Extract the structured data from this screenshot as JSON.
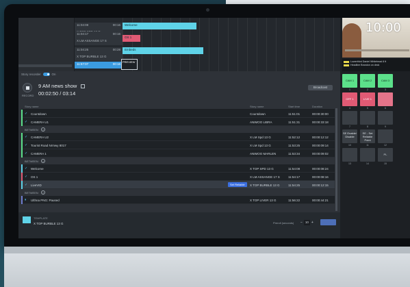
{
  "timeline": {
    "rows": [
      {
        "time": "11:04:08",
        "dur": "00:16",
        "label": "X TOP SPD 13 G"
      },
      {
        "time": "11:04:17",
        "dur": "00:16",
        "label": "X LM ASSANGE 17 S"
      },
      {
        "time": "11:04:25",
        "dur": "00:28",
        "label": "X TOP BURBLE 13 G"
      }
    ],
    "selected_time": "11:57:07",
    "selected_dur": "00:16",
    "blocks": [
      {
        "label": "Welcome",
        "color": "#5fd3e8"
      },
      {
        "label": "OS 1",
        "color": "#e05a74"
      },
      {
        "label": "Embeds",
        "color": "#5fd3e8"
      }
    ],
    "playhead_label": "PREVIEW"
  },
  "story_recorder": {
    "label": "Story recorder",
    "state": "On"
  },
  "show": {
    "record_label": "RECORD",
    "title": "9 AM news show",
    "elapsed": "00:02:50",
    "total": "03:14",
    "broadcast_label": "Broadcast"
  },
  "table": {
    "columns": [
      "Story name",
      "Story name",
      "Start time",
      "Duration"
    ],
    "rows": [
      {
        "kind": "row",
        "name": "Countdown",
        "story": "Countdown",
        "start": "11:51:01",
        "duration": "00:00:30:00",
        "bar": "#5ce08a"
      },
      {
        "kind": "row",
        "name": "CAMERA U1",
        "story": "ANIMOO LIBRA",
        "start": "11:51:31",
        "duration": "00:00:33:18",
        "bar": "#5ce08a"
      },
      {
        "kind": "divider",
        "name": "BETWEEN"
      },
      {
        "kind": "row",
        "name": "CAMERA U2",
        "story": "X LM Spd 13 G",
        "start": "11:52:12",
        "duration": "00:00:12:12",
        "bar": "#5ce08a"
      },
      {
        "kind": "row",
        "name": "Tourist Road Nrmwy 8017",
        "story": "X LM Spd 13 G",
        "start": "11:53:25",
        "duration": "00:00:09:14",
        "bar": "#5ce08a"
      },
      {
        "kind": "row",
        "name": "CAMERA 1",
        "story": "ANIMOO MARLEN",
        "start": "11:53:34",
        "duration": "00:00:09:02",
        "bar": "#5ce08a"
      },
      {
        "kind": "divider",
        "name": "BETWEEN"
      },
      {
        "kind": "row",
        "name": "Welcome",
        "story": "X TOP SPD 13 G",
        "start": "11:54:08",
        "duration": "00:00:08:24",
        "bar": "#5fd3e8"
      },
      {
        "kind": "row",
        "name": "OS 1",
        "story": "X LM ASSANGE 17 S",
        "start": "11:54:17",
        "duration": "00:00:08:16",
        "bar": "#e05a74"
      },
      {
        "kind": "row",
        "name": "LiveVID",
        "story": "X TOP BURBLE 13 G",
        "start": "11:54:25",
        "duration": "00:00:12:15",
        "bar": "#5fd3e8",
        "tag": "Set Reliable",
        "highlight": true
      },
      {
        "kind": "divider",
        "name": "BETWEEN"
      },
      {
        "kind": "row",
        "name": "Ulthna PNG: Paused",
        "story": "X TOP LIVER 13 G",
        "start": "11:56:22",
        "duration": "00:00:44:21",
        "bar": "#6f7dd0",
        "icon": "pause"
      }
    ]
  },
  "footer": {
    "label": "TEMPLATE",
    "sub": "X TOP BURBLE 13 G",
    "preroll_label": "Preroll (seconds)",
    "preroll_value": "10"
  },
  "right": {
    "clock": "10:00",
    "lower_third": [
      "Lowerthird Daniel Whitehead 8 ft",
      "Headline Brandon on deck"
    ],
    "buttons": [
      {
        "label": "CAM 1",
        "caption": "1",
        "style": "green"
      },
      {
        "label": "CAM 2",
        "caption": "2",
        "style": "green"
      },
      {
        "label": "CAM 3",
        "caption": "3",
        "style": "green"
      },
      {
        "label": "OFF 1",
        "caption": "4",
        "style": "red"
      },
      {
        "label": "LIVE 1",
        "caption": "5",
        "style": "red"
      },
      {
        "label": "",
        "caption": "6",
        "style": "pink"
      },
      {
        "label": "",
        "caption": "7",
        "style": "gray"
      },
      {
        "label": "",
        "caption": "8",
        "style": "gray"
      },
      {
        "label": "",
        "caption": "9",
        "style": "gray"
      },
      {
        "label": "SE Enable/ Disable",
        "caption": "10",
        "style": "dark"
      },
      {
        "label": "SE - Set Reliable Point",
        "caption": "11",
        "style": "dark"
      },
      {
        "label": "",
        "caption": "12",
        "style": "gray"
      },
      {
        "label": "",
        "caption": "13",
        "style": "gray"
      },
      {
        "label": "",
        "caption": "14",
        "style": "gray"
      },
      {
        "label": "PL",
        "caption": "15",
        "style": "gray"
      }
    ]
  }
}
